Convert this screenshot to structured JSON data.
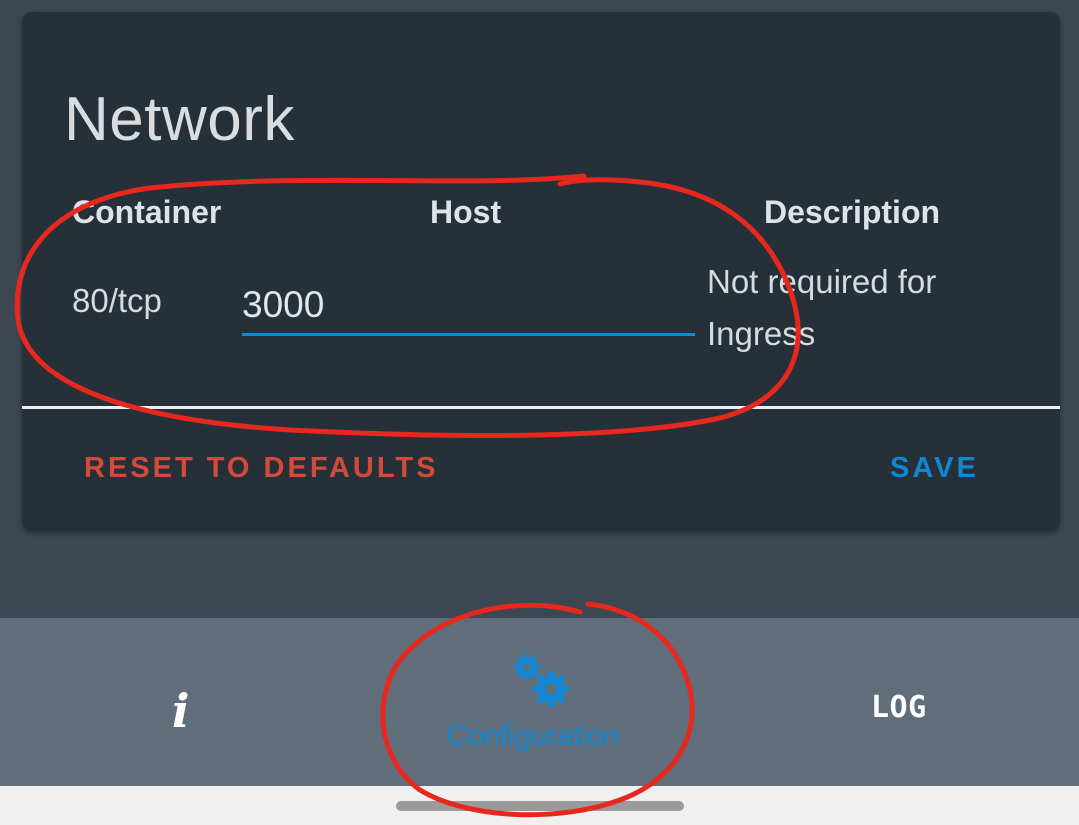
{
  "card": {
    "title": "Network",
    "columns": {
      "container": "Container",
      "host": "Host",
      "description": "Description"
    },
    "row": {
      "container": "80/tcp",
      "host": "3000",
      "description": "Not required for Ingress"
    },
    "actions": {
      "reset": "RESET TO DEFAULTS",
      "save": "SAVE"
    }
  },
  "bottom_nav": {
    "info_icon": "i",
    "configuration_label": "Configuration",
    "log_label": "LOG"
  },
  "colors": {
    "accent": "#1286d2",
    "reset": "#d24a3c",
    "annotation": "#e8281e"
  }
}
